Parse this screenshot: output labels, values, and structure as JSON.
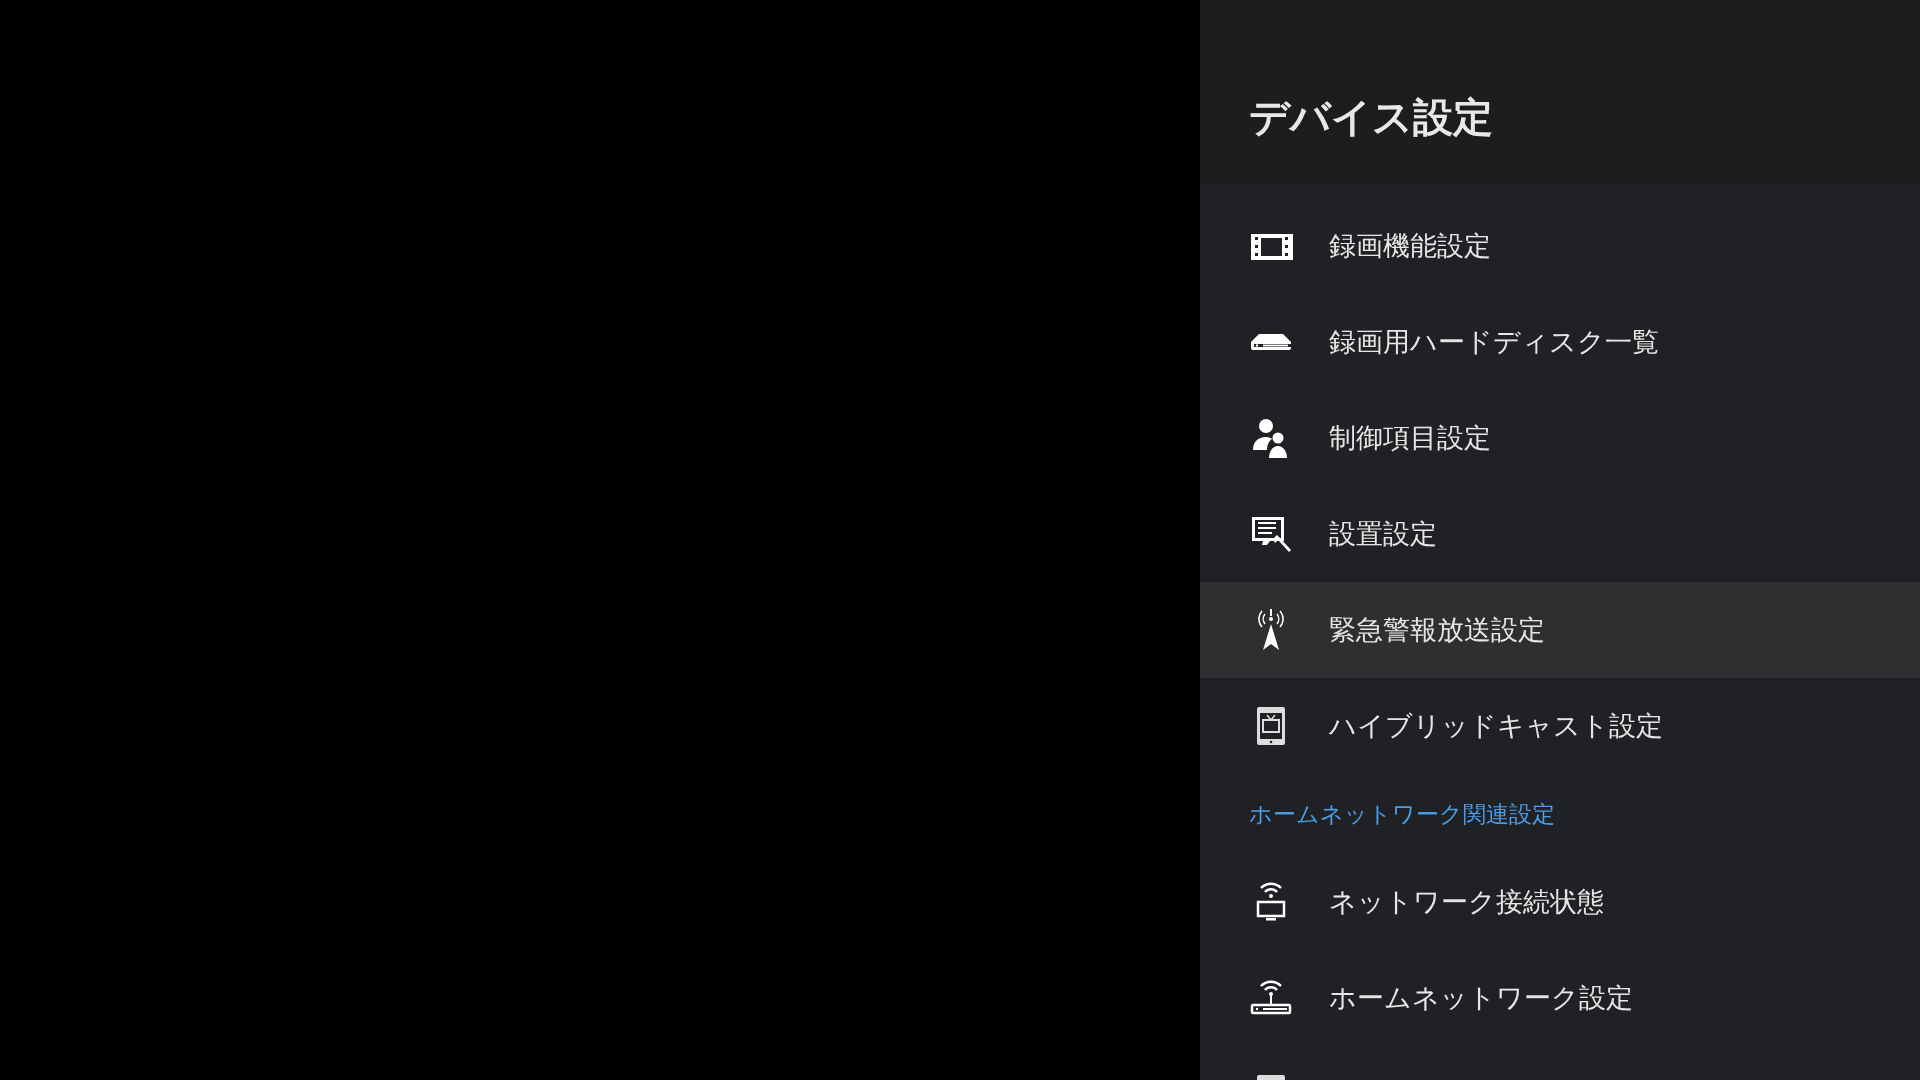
{
  "panel": {
    "title": "デバイス設定"
  },
  "items": [
    {
      "kind": "entry",
      "label": "録画機能設定",
      "selected": false
    },
    {
      "kind": "entry",
      "label": "録画用ハードディスク一覧",
      "selected": false
    },
    {
      "kind": "entry",
      "label": "制御項目設定",
      "selected": false
    },
    {
      "kind": "entry",
      "label": "設置設定",
      "selected": false
    },
    {
      "kind": "entry",
      "label": "緊急警報放送設定",
      "selected": true
    },
    {
      "kind": "entry",
      "label": "ハイブリッドキャスト設定",
      "selected": false
    },
    {
      "kind": "section",
      "label": "ホームネットワーク関連設定"
    },
    {
      "kind": "entry",
      "label": "ネットワーク接続状態",
      "selected": false
    },
    {
      "kind": "entry",
      "label": "ホームネットワーク設定",
      "selected": false
    },
    {
      "kind": "partial"
    }
  ]
}
